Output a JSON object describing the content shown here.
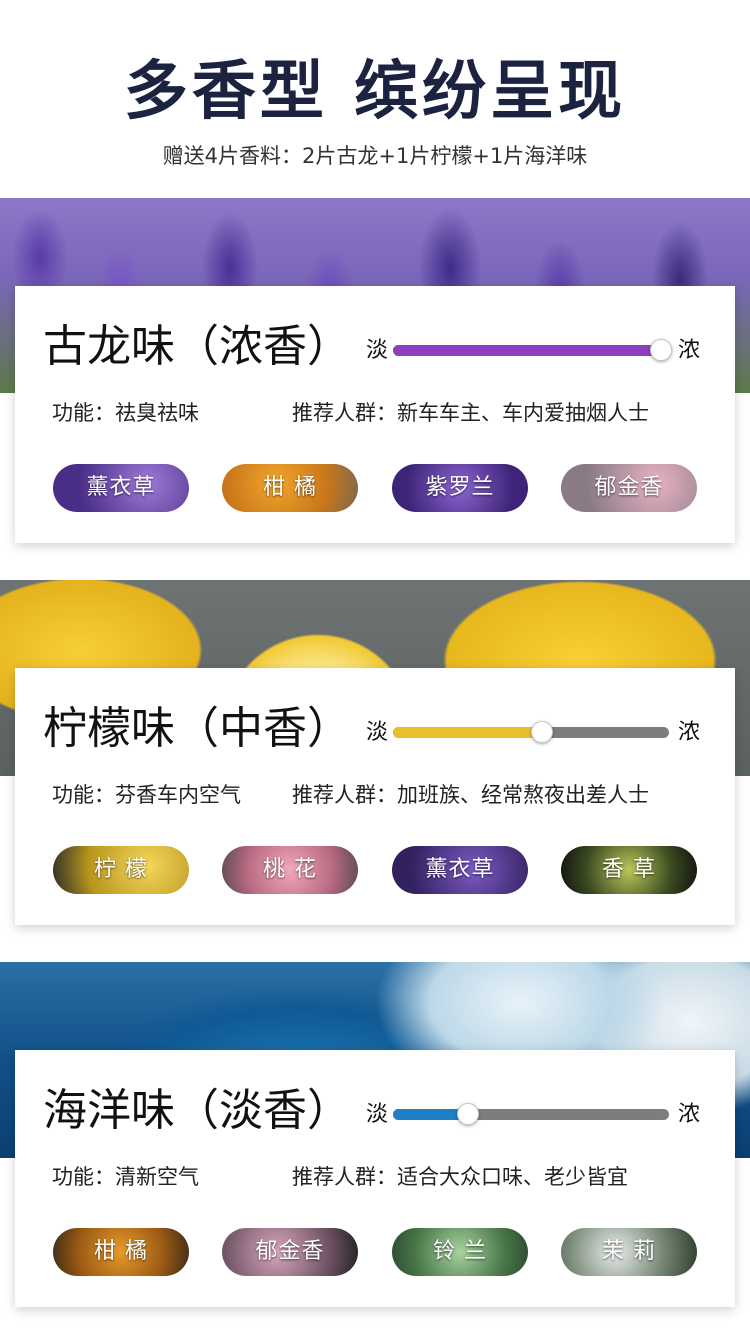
{
  "header": {
    "title": "多香型 缤纷呈现",
    "subtitle": "赠送4片香料：2片古龙+1片柠檬+1片海洋味"
  },
  "cards": [
    {
      "name": "古龙味（浓香）",
      "slider": {
        "left": "淡",
        "right": "浓",
        "level_percent": 97,
        "color": "#8e3fc0"
      },
      "function": "功能：祛臭祛味",
      "crowd": "推荐人群：新车车主、车内爱抽烟人士",
      "chips": [
        {
          "label": "薰衣草",
          "icon": "lavender-image"
        },
        {
          "label": "柑 橘",
          "icon": "orange-image"
        },
        {
          "label": "紫罗兰",
          "icon": "violet-image"
        },
        {
          "label": "郁金香",
          "icon": "tulip-image"
        }
      ]
    },
    {
      "name": "柠檬味（中香）",
      "slider": {
        "left": "淡",
        "right": "浓",
        "level_percent": 54,
        "color": "#e8bf2c"
      },
      "function": "功能：芬香车内空气",
      "crowd": "推荐人群：加班族、经常熬夜出差人士",
      "chips": [
        {
          "label": "柠 檬",
          "icon": "lemon-image"
        },
        {
          "label": "桃 花",
          "icon": "peach-blossom-image"
        },
        {
          "label": "薰衣草",
          "icon": "lavender-image"
        },
        {
          "label": "香 草",
          "icon": "vanilla-image"
        }
      ]
    },
    {
      "name": "海洋味（淡香）",
      "slider": {
        "left": "淡",
        "right": "浓",
        "level_percent": 27,
        "color": "#1f7ec6"
      },
      "function": "功能：清新空气",
      "crowd": "推荐人群：适合大众口味、老少皆宜",
      "chips": [
        {
          "label": "柑 橘",
          "icon": "orange-image"
        },
        {
          "label": "郁金香",
          "icon": "tulip-image"
        },
        {
          "label": "铃 兰",
          "icon": "lily-of-valley-image"
        },
        {
          "label": "茉 莉",
          "icon": "jasmine-image"
        }
      ]
    }
  ]
}
